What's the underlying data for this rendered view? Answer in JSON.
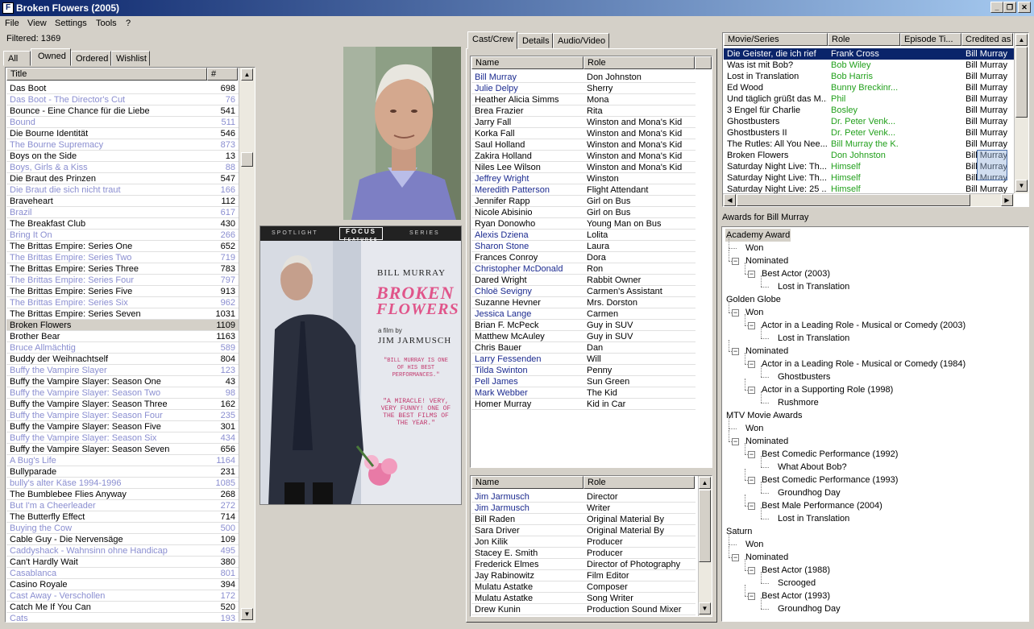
{
  "window": {
    "title": "Broken Flowers (2005)",
    "app_icon": "F"
  },
  "menu": [
    "File",
    "View",
    "Settings",
    "Tools",
    "?"
  ],
  "filtered": "Filtered: 1369",
  "list_tabs": [
    "All",
    "Owned",
    "Ordered",
    "Wishlist"
  ],
  "list_active_tab": 1,
  "movie_list": {
    "headers": [
      "Title",
      "#"
    ],
    "rows": [
      {
        "t": "Das Boot",
        "n": "698",
        "s": "n"
      },
      {
        "t": "Das Boot - The Director's Cut",
        "n": "76",
        "s": "g"
      },
      {
        "t": "Bounce - Eine Chance für die Liebe",
        "n": "541",
        "s": "n"
      },
      {
        "t": "Bound",
        "n": "511",
        "s": "g"
      },
      {
        "t": "Die Bourne Identität",
        "n": "546",
        "s": "n"
      },
      {
        "t": "The Bourne Supremacy",
        "n": "873",
        "s": "g"
      },
      {
        "t": "Boys on the Side",
        "n": "13",
        "s": "n"
      },
      {
        "t": "Boys, Girls & a Kiss",
        "n": "88",
        "s": "g"
      },
      {
        "t": "Die Braut des Prinzen",
        "n": "547",
        "s": "n"
      },
      {
        "t": "Die Braut die sich nicht traut",
        "n": "166",
        "s": "g"
      },
      {
        "t": "Braveheart",
        "n": "112",
        "s": "n"
      },
      {
        "t": "Brazil",
        "n": "617",
        "s": "g"
      },
      {
        "t": "The Breakfast Club",
        "n": "430",
        "s": "n"
      },
      {
        "t": "Bring It On",
        "n": "266",
        "s": "g"
      },
      {
        "t": "The Brittas Empire: Series One",
        "n": "652",
        "s": "n"
      },
      {
        "t": "The Brittas Empire: Series Two",
        "n": "719",
        "s": "g"
      },
      {
        "t": "The Brittas Empire: Series Three",
        "n": "783",
        "s": "n"
      },
      {
        "t": "The Brittas Empire: Series Four",
        "n": "797",
        "s": "g"
      },
      {
        "t": "The Brittas Empire: Series Five",
        "n": "913",
        "s": "n"
      },
      {
        "t": "The Brittas Empire: Series Six",
        "n": "962",
        "s": "g"
      },
      {
        "t": "The Brittas Empire: Series Seven",
        "n": "1031",
        "s": "n"
      },
      {
        "t": "Broken Flowers",
        "n": "1109",
        "s": "h"
      },
      {
        "t": "Brother Bear",
        "n": "1163",
        "s": "n"
      },
      {
        "t": "Bruce Allmächtig",
        "n": "589",
        "s": "g"
      },
      {
        "t": "Buddy der Weihnachtself",
        "n": "804",
        "s": "n"
      },
      {
        "t": "Buffy the Vampire Slayer",
        "n": "123",
        "s": "g"
      },
      {
        "t": "Buffy the Vampire Slayer: Season One",
        "n": "43",
        "s": "n"
      },
      {
        "t": "Buffy the Vampire Slayer: Season Two",
        "n": "98",
        "s": "g"
      },
      {
        "t": "Buffy the Vampire Slayer: Season Three",
        "n": "162",
        "s": "n"
      },
      {
        "t": "Buffy the Vampire Slayer: Season Four",
        "n": "235",
        "s": "g"
      },
      {
        "t": "Buffy the Vampire Slayer: Season Five",
        "n": "301",
        "s": "n"
      },
      {
        "t": "Buffy the Vampire Slayer: Season Six",
        "n": "434",
        "s": "g"
      },
      {
        "t": "Buffy the Vampire Slayer: Season Seven",
        "n": "656",
        "s": "n"
      },
      {
        "t": "A Bug's Life",
        "n": "1164",
        "s": "g"
      },
      {
        "t": "Bullyparade",
        "n": "231",
        "s": "n"
      },
      {
        "t": "bully's alter Käse 1994-1996",
        "n": "1085",
        "s": "g"
      },
      {
        "t": "The Bumblebee Flies Anyway",
        "n": "268",
        "s": "n"
      },
      {
        "t": "But I'm a Cheerleader",
        "n": "272",
        "s": "g"
      },
      {
        "t": "The Butterfly Effect",
        "n": "714",
        "s": "n"
      },
      {
        "t": "Buying the Cow",
        "n": "500",
        "s": "g"
      },
      {
        "t": "Cable Guy - Die Nervensäge",
        "n": "109",
        "s": "n"
      },
      {
        "t": "Caddyshack - Wahnsinn ohne Handicap",
        "n": "495",
        "s": "g"
      },
      {
        "t": "Can't Hardly Wait",
        "n": "380",
        "s": "n"
      },
      {
        "t": "Casablanca",
        "n": "801",
        "s": "g"
      },
      {
        "t": "Casino Royale",
        "n": "394",
        "s": "n"
      },
      {
        "t": "Cast Away - Verschollen",
        "n": "172",
        "s": "g"
      },
      {
        "t": "Catch Me If You Can",
        "n": "520",
        "s": "n"
      },
      {
        "t": "Cats",
        "n": "193",
        "s": "g"
      }
    ]
  },
  "poster": {
    "strip_left": "SPOTLIGHT",
    "strip_logo": "FOCUS",
    "strip_logo_sub": "FEATURES",
    "strip_right": "SERIES",
    "actor": "BILL MURRAY",
    "title1": "BROKEN",
    "title2": "FLOWERS",
    "by1": "a film by",
    "by2": "JIM JARMUSCH",
    "quote1": "\"BILL MURRAY IS ONE OF HIS BEST PERFORMANCES.\"",
    "quote2": "\"A MIRACLE! VERY, VERY FUNNY! ONE OF THE BEST FILMS OF THE YEAR.\""
  },
  "detail_tabs": [
    "Cast/Crew",
    "Details",
    "Audio/Video"
  ],
  "cast": {
    "headers": [
      "Name",
      "Role"
    ],
    "rows": [
      {
        "n": "Bill Murray",
        "r": "Don Johnston",
        "b": true
      },
      {
        "n": "Julie Delpy",
        "r": "Sherry",
        "b": true
      },
      {
        "n": "Heather Alicia Simms",
        "r": "Mona",
        "b": false
      },
      {
        "n": "Brea Frazier",
        "r": "Rita",
        "b": false
      },
      {
        "n": "Jarry Fall",
        "r": "Winston and Mona's Kid",
        "b": false
      },
      {
        "n": "Korka Fall",
        "r": "Winston and Mona's Kid",
        "b": false
      },
      {
        "n": "Saul Holland",
        "r": "Winston and Mona's Kid",
        "b": false
      },
      {
        "n": "Zakira Holland",
        "r": "Winston and Mona's Kid",
        "b": false
      },
      {
        "n": "Niles Lee Wilson",
        "r": "Winston and Mona's Kid",
        "b": false
      },
      {
        "n": "Jeffrey Wright",
        "r": "Winston",
        "b": true
      },
      {
        "n": "Meredith Patterson",
        "r": "Flight Attendant",
        "b": true
      },
      {
        "n": "Jennifer Rapp",
        "r": "Girl on Bus",
        "b": false
      },
      {
        "n": "Nicole Abisinio",
        "r": "Girl on Bus",
        "b": false
      },
      {
        "n": "Ryan Donowho",
        "r": "Young Man on Bus",
        "b": false
      },
      {
        "n": "Alexis Dziena",
        "r": "Lolita",
        "b": true
      },
      {
        "n": "Sharon Stone",
        "r": "Laura",
        "b": true
      },
      {
        "n": "Frances Conroy",
        "r": "Dora",
        "b": false
      },
      {
        "n": "Christopher McDonald",
        "r": "Ron",
        "b": true
      },
      {
        "n": "Dared Wright",
        "r": "Rabbit Owner",
        "b": false
      },
      {
        "n": "Chloë Sevigny",
        "r": "Carmen's Assistant",
        "b": true
      },
      {
        "n": "Suzanne Hevner",
        "r": "Mrs. Dorston",
        "b": false
      },
      {
        "n": "Jessica Lange",
        "r": "Carmen",
        "b": true
      },
      {
        "n": "Brian F. McPeck",
        "r": "Guy in SUV",
        "b": false
      },
      {
        "n": "Matthew McAuley",
        "r": "Guy in SUV",
        "b": false
      },
      {
        "n": "Chris Bauer",
        "r": "Dan",
        "b": false
      },
      {
        "n": "Larry Fessenden",
        "r": "Will",
        "b": true
      },
      {
        "n": "Tilda Swinton",
        "r": "Penny",
        "b": true
      },
      {
        "n": "Pell James",
        "r": "Sun Green",
        "b": true
      },
      {
        "n": "Mark Webber",
        "r": "The Kid",
        "b": true
      },
      {
        "n": "Homer Murray",
        "r": "Kid in Car",
        "b": false
      }
    ]
  },
  "crew": {
    "headers": [
      "Name",
      "Role"
    ],
    "rows": [
      {
        "n": "Jim Jarmusch",
        "r": "Director",
        "b": true
      },
      {
        "n": "Jim Jarmusch",
        "r": "Writer",
        "b": true
      },
      {
        "n": "Bill Raden",
        "r": "Original Material By",
        "b": false
      },
      {
        "n": "Sara Driver",
        "r": "Original Material By",
        "b": false
      },
      {
        "n": "Jon Kilik",
        "r": "Producer",
        "b": false
      },
      {
        "n": "Stacey E. Smith",
        "r": "Producer",
        "b": false
      },
      {
        "n": "Frederick Elmes",
        "r": "Director of Photography",
        "b": false
      },
      {
        "n": "Jay Rabinowitz",
        "r": "Film Editor",
        "b": false
      },
      {
        "n": "Mulatu Astatke",
        "r": "Composer",
        "b": false
      },
      {
        "n": "Mulatu Astatke",
        "r": "Song Writer",
        "b": false
      },
      {
        "n": "Drew Kunin",
        "r": "Production Sound Mixer",
        "b": false
      }
    ]
  },
  "filmography": {
    "headers": [
      "Movie/Series",
      "Role",
      "Episode Ti...",
      "Credited as"
    ],
    "rows": [
      {
        "m": "Die Geister, die ich rief",
        "r": "Frank Cross",
        "c": "Bill Murray",
        "sel": true,
        "g": true
      },
      {
        "m": "Was ist mit Bob?",
        "r": "Bob Wiley",
        "c": "Bill Murray",
        "sel": false,
        "g": true
      },
      {
        "m": "Lost in Translation",
        "r": "Bob Harris",
        "c": "Bill Murray",
        "sel": false,
        "g": true
      },
      {
        "m": "Ed Wood",
        "r": "Bunny Breckinr...",
        "c": "Bill Murray",
        "sel": false,
        "g": true
      },
      {
        "m": "Und täglich grüßt das M...",
        "r": "Phil",
        "c": "Bill Murray",
        "sel": false,
        "g": true
      },
      {
        "m": "3 Engel für Charlie",
        "r": "Bosley",
        "c": "Bill Murray",
        "sel": false,
        "g": true
      },
      {
        "m": "Ghostbusters",
        "r": "Dr. Peter Venk...",
        "c": "Bill Murray",
        "sel": false,
        "g": true
      },
      {
        "m": "Ghostbusters II",
        "r": "Dr. Peter Venk...",
        "c": "Bill Murray",
        "sel": false,
        "g": true
      },
      {
        "m": "The Rutles: All You Nee...",
        "r": "Bill Murray the K.",
        "c": "Bill Murray",
        "sel": false,
        "g": true
      },
      {
        "m": "Broken Flowers",
        "r": "Don Johnston",
        "c": "Bill Murray",
        "sel": false,
        "g": true
      },
      {
        "m": "Saturday Night Live: Th...",
        "r": "Himself",
        "c": "Bill Murray",
        "sel": false,
        "g": true
      },
      {
        "m": "Saturday Night Live: Th...",
        "r": "Himself",
        "c": "Bill Murray",
        "sel": false,
        "g": true
      },
      {
        "m": "Saturday Night Live: 25 ...",
        "r": "Himself",
        "c": "Bill Murray",
        "sel": false,
        "g": true
      }
    ]
  },
  "awards_label": "Awards for Bill Murray",
  "awards_tree": [
    {
      "text": "Academy Award",
      "lvl": 0,
      "box": "",
      "hl": true
    },
    {
      "text": "Won",
      "lvl": 1,
      "box": "",
      "hl": false
    },
    {
      "text": "Nominated",
      "lvl": 1,
      "box": "−",
      "hl": false
    },
    {
      "text": "Best Actor (2003)",
      "lvl": 2,
      "box": "−",
      "hl": false
    },
    {
      "text": "Lost in Translation",
      "lvl": 3,
      "box": "",
      "hl": false
    },
    {
      "text": "Golden Globe",
      "lvl": 0,
      "box": "",
      "hl": false
    },
    {
      "text": "Won",
      "lvl": 1,
      "box": "−",
      "hl": false
    },
    {
      "text": "Actor in a Leading Role - Musical or Comedy (2003)",
      "lvl": 2,
      "box": "−",
      "hl": false
    },
    {
      "text": "Lost in Translation",
      "lvl": 3,
      "box": "",
      "hl": false
    },
    {
      "text": "Nominated",
      "lvl": 1,
      "box": "−",
      "hl": false
    },
    {
      "text": "Actor in a Leading Role - Musical or Comedy (1984)",
      "lvl": 2,
      "box": "−",
      "hl": false
    },
    {
      "text": "Ghostbusters",
      "lvl": 3,
      "box": "",
      "hl": false
    },
    {
      "text": "Actor in a Supporting Role (1998)",
      "lvl": 2,
      "box": "−",
      "hl": false
    },
    {
      "text": "Rushmore",
      "lvl": 3,
      "box": "",
      "hl": false
    },
    {
      "text": "MTV Movie Awards",
      "lvl": 0,
      "box": "",
      "hl": false
    },
    {
      "text": "Won",
      "lvl": 1,
      "box": "",
      "hl": false
    },
    {
      "text": "Nominated",
      "lvl": 1,
      "box": "−",
      "hl": false
    },
    {
      "text": "Best Comedic Performance (1992)",
      "lvl": 2,
      "box": "−",
      "hl": false
    },
    {
      "text": "What About Bob?",
      "lvl": 3,
      "box": "",
      "hl": false
    },
    {
      "text": "Best Comedic Performance (1993)",
      "lvl": 2,
      "box": "−",
      "hl": false
    },
    {
      "text": "Groundhog Day",
      "lvl": 3,
      "box": "",
      "hl": false
    },
    {
      "text": "Best Male Performance (2004)",
      "lvl": 2,
      "box": "−",
      "hl": false
    },
    {
      "text": "Lost in Translation",
      "lvl": 3,
      "box": "",
      "hl": false
    },
    {
      "text": "Saturn",
      "lvl": 0,
      "box": "",
      "hl": false
    },
    {
      "text": "Won",
      "lvl": 1,
      "box": "",
      "hl": false
    },
    {
      "text": "Nominated",
      "lvl": 1,
      "box": "−",
      "hl": false
    },
    {
      "text": "Best Actor (1988)",
      "lvl": 2,
      "box": "−",
      "hl": false
    },
    {
      "text": "Scrooged",
      "lvl": 3,
      "box": "",
      "hl": false
    },
    {
      "text": "Best Actor (1993)",
      "lvl": 2,
      "box": "−",
      "hl": false
    },
    {
      "text": "Groundhog Day",
      "lvl": 3,
      "box": "",
      "hl": false
    }
  ],
  "icons": {
    "app": "film-icon",
    "minimize": "minimize-icon",
    "restore": "restore-icon",
    "close": "close-icon"
  },
  "colors": {
    "titlebar": "#0a246a",
    "selection": "#0a246a",
    "owned_link": "#1b2a8f",
    "not_owned": "#8a8ed0",
    "role_link": "#22a01c"
  }
}
